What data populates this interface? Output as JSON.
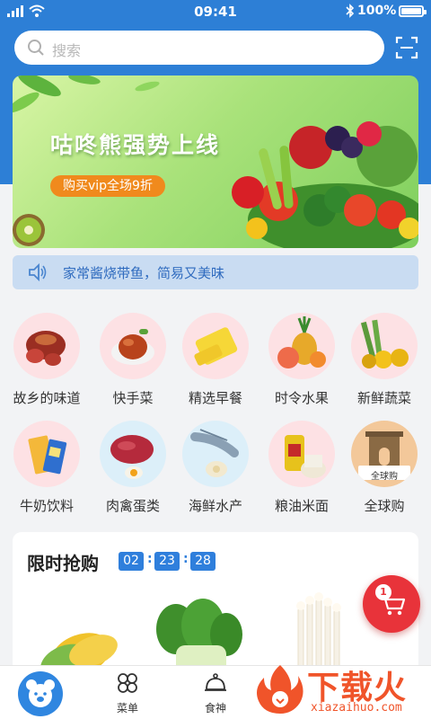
{
  "status_bar": {
    "time": "09:41",
    "battery": "100%",
    "battery_level": 1.0
  },
  "search": {
    "placeholder": "搜索"
  },
  "banner": {
    "title": "咕咚熊强势上线",
    "promo": "购买vip全场9折"
  },
  "notice": {
    "text": "家常酱烧带鱼，简易又美味"
  },
  "categories": [
    {
      "label": "故乡的味道",
      "icon": "ham-icon"
    },
    {
      "label": "快手菜",
      "icon": "braised-chicken-icon"
    },
    {
      "label": "精选早餐",
      "icon": "egg-roll-icon"
    },
    {
      "label": "时令水果",
      "icon": "fruit-icon"
    },
    {
      "label": "新鲜蔬菜",
      "icon": "vegetables-icon"
    },
    {
      "label": "牛奶饮料",
      "icon": "milk-drink-icon"
    },
    {
      "label": "肉禽蛋类",
      "icon": "meat-egg-icon"
    },
    {
      "label": "海鲜水产",
      "icon": "shrimp-icon"
    },
    {
      "label": "粮油米面",
      "icon": "oil-rice-icon"
    },
    {
      "label": "全球购",
      "icon": "arch-icon",
      "badge": "全球购"
    }
  ],
  "flash_sale": {
    "title": "限时抢购",
    "countdown": {
      "hours": "02",
      "minutes": "23",
      "seconds": "28"
    }
  },
  "cart": {
    "count": "1"
  },
  "tabbar": {
    "menu": "菜单",
    "chef": "食神"
  },
  "watermark": {
    "brand": "下载火",
    "domain": "xiazaihuo.com"
  },
  "colors": {
    "primary": "#2d7fd6",
    "accent": "#e8333a",
    "promo": "#f08a1d"
  }
}
